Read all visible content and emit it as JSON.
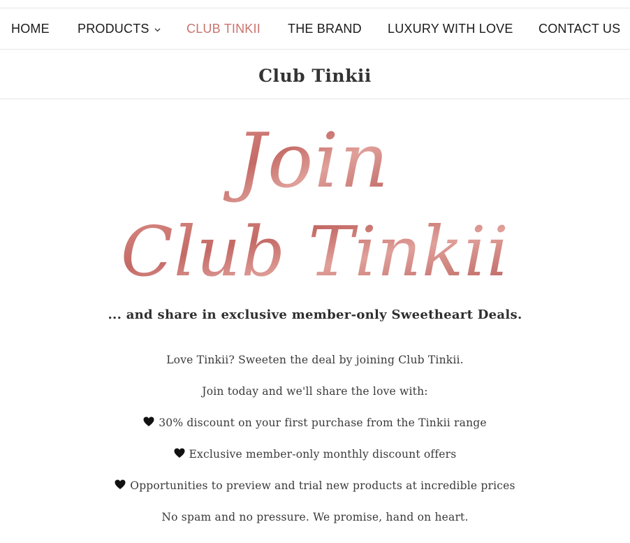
{
  "nav": {
    "items": [
      {
        "label": "HOME"
      },
      {
        "label": "PRODUCTS"
      },
      {
        "label": "CLUB TINKII"
      },
      {
        "label": "THE BRAND"
      },
      {
        "label": "LUXURY WITH LOVE"
      },
      {
        "label": "CONTACT US"
      }
    ],
    "active": "CLUB TINKII"
  },
  "page": {
    "title": "Club Tinkii"
  },
  "banner": {
    "line1": "Join",
    "line2": "Club Tinkii",
    "color": "#c9746f"
  },
  "content": {
    "lead": "... and share in exclusive member-only Sweetheart Deals.",
    "intro": "Love Tinkii?  Sweeten the deal by joining Club Tinkii.",
    "join": "Join today and we'll share the love with:",
    "benefits": [
      "30% discount on your first purchase from the Tinkii range",
      "Exclusive member-only monthly discount offers",
      "Opportunities to preview and trial new products at incredible prices"
    ],
    "closing": "No spam and no pressure. We promise, hand on heart."
  },
  "colors": {
    "accent": "#c9746f",
    "text": "#3a3a3a",
    "divider": "#e6e6e6"
  }
}
